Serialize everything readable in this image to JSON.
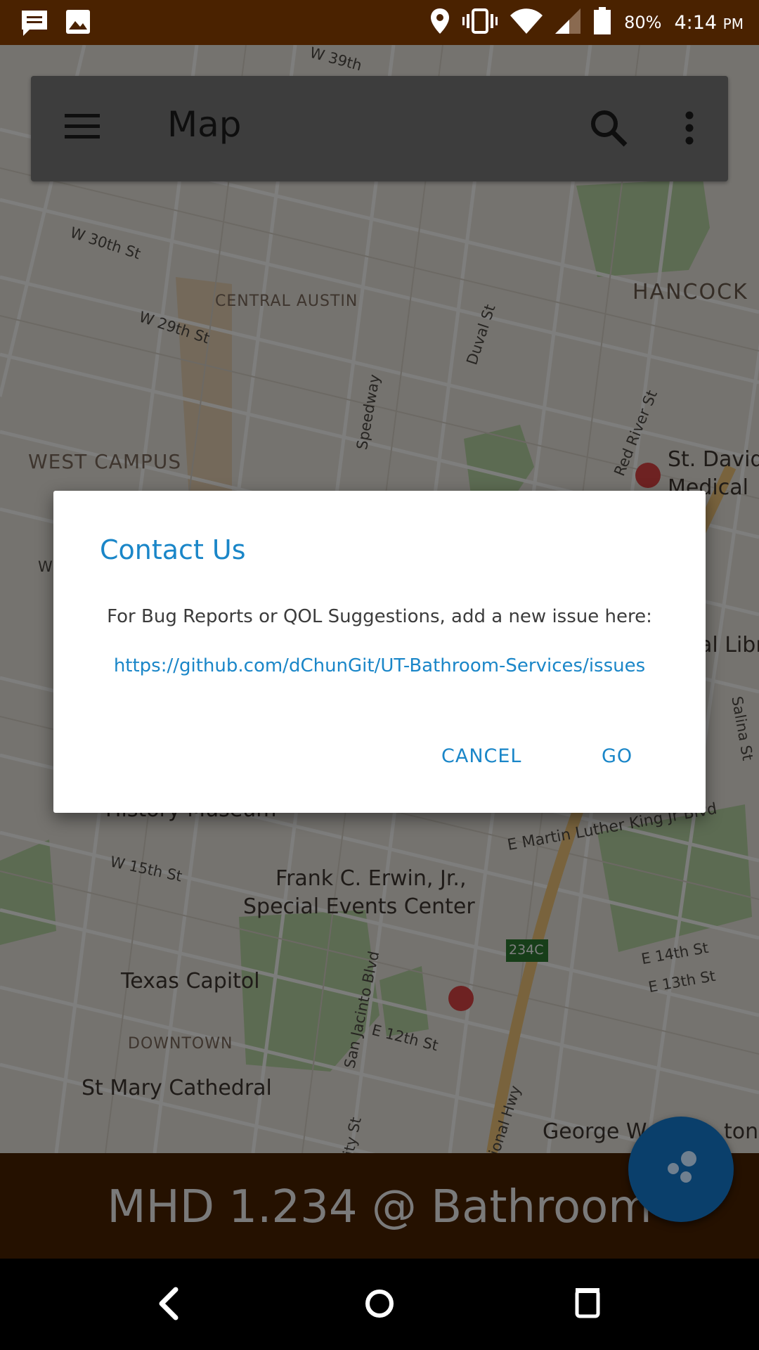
{
  "status_bar": {
    "battery_percent": "80%",
    "time": "4:14",
    "ampm": "PM",
    "icons": [
      "message-icon",
      "image-icon",
      "location-icon",
      "vibrate-icon",
      "wifi-icon",
      "signal-icon",
      "battery-icon"
    ]
  },
  "app_bar": {
    "title": "Map",
    "icons": [
      "menu-icon",
      "search-icon",
      "more-vert-icon"
    ]
  },
  "map": {
    "labels": {
      "w39": "W 39th",
      "w30": "W 30th St",
      "w29": "W 29th St",
      "central_austin": "CENTRAL AUSTIN",
      "hancock": "HANCOCK",
      "duval": "Duval St",
      "speedway": "Speedway",
      "red_river": "Red River St",
      "west_campus": "WEST CAMPUS",
      "st_david": "St. David",
      "medical": "Medical",
      "w_partial": "W",
      "libr": "al Libr",
      "salina": "Salina St",
      "history_museum": "History Museum",
      "mlk": "E Martin Luther King Jr Blvd",
      "w15": "W 15th St",
      "erwin1": "Frank C. Erwin, Jr.,",
      "erwin2": "Special Events Center",
      "exit_234c": "234C",
      "e14": "E 14th St",
      "e13": "E 13th St",
      "texas_capitol": "Texas Capitol",
      "san_jacinto": "San Jacinto Blvd",
      "downtown": "DOWNTOWN",
      "e12": "E 12th St",
      "regional_hwy": "egional Hwy",
      "st_mary": "St Mary Cathedral",
      "city_st": "ity St",
      "george": "George W",
      "ton": "ton"
    }
  },
  "dialog": {
    "title": "Contact Us",
    "message": "For Bug Reports or QOL Suggestions, add a new issue here:",
    "link": "https://github.com/dChunGit/UT-Bathroom-Services/issues",
    "cancel_label": "CANCEL",
    "go_label": "GO"
  },
  "banner": {
    "text": "MHD 1.234 @ Bathroom"
  },
  "nav_bar": {
    "icons": [
      "back-icon",
      "home-icon",
      "recents-icon"
    ]
  },
  "colors": {
    "status_bar": "#4a2200",
    "accent": "#1a86c8",
    "fab": "#0a3f6b"
  }
}
